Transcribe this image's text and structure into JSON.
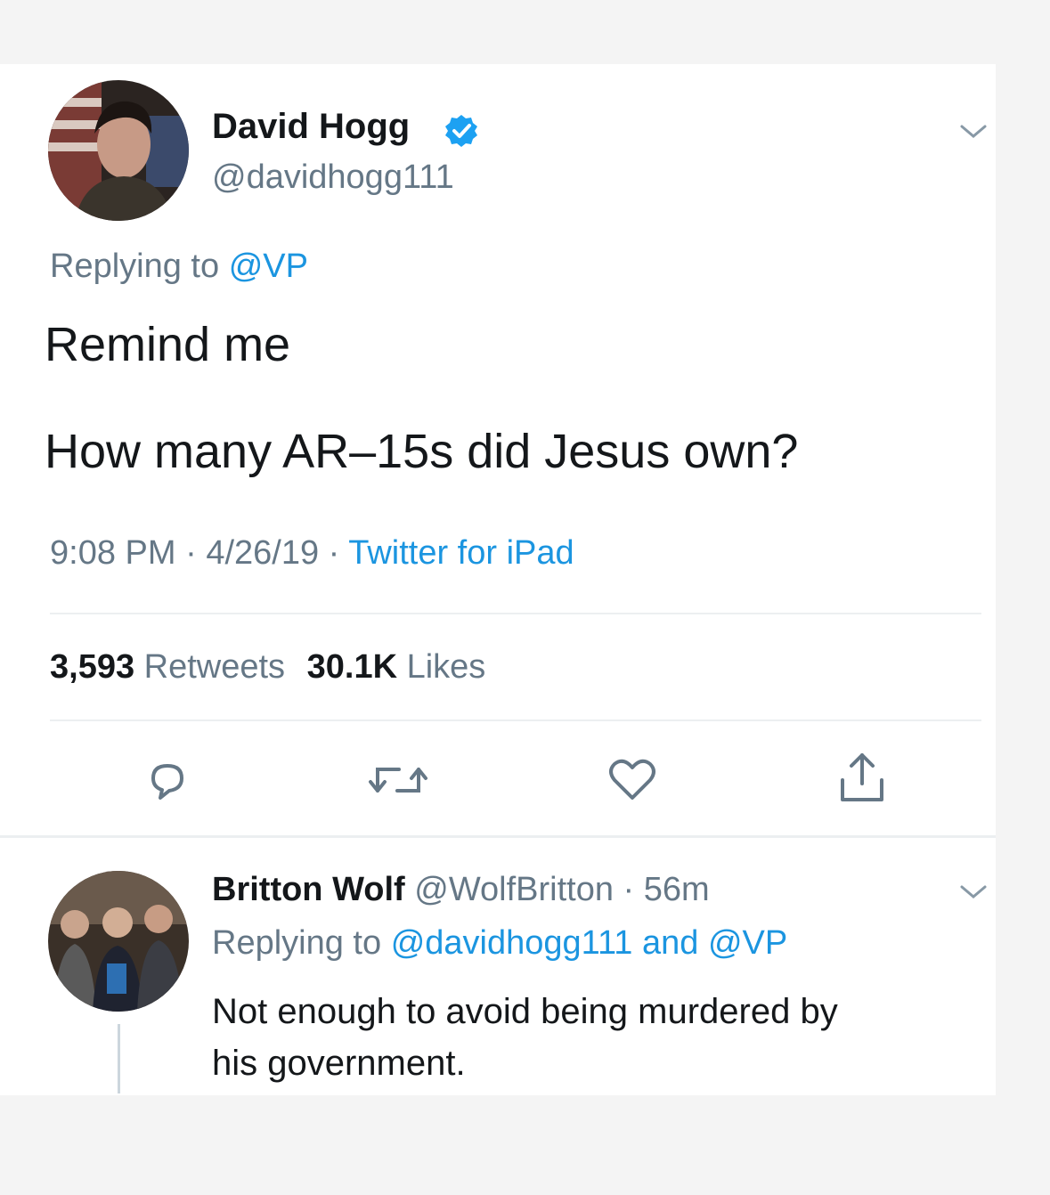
{
  "tweet": {
    "author": {
      "name": "David Hogg",
      "handle": "@davidhogg111",
      "verified": true,
      "verified_badge_icon": "verified-badge-icon"
    },
    "replying_prefix": "Replying to",
    "replying_to": "@VP",
    "text_line1": "Remind me",
    "text_line2": "How many AR–15s did Jesus own?",
    "time": "9:08 PM",
    "date": "4/26/19",
    "source": "Twitter for iPad",
    "dot": "·",
    "retweets_count": "3,593",
    "retweets_label": "Retweets",
    "likes_count": "30.1K",
    "likes_label": "Likes",
    "actions": [
      "reply-icon",
      "retweet-icon",
      "like-icon",
      "share-icon"
    ]
  },
  "reply": {
    "author": {
      "name": "Britton Wolf",
      "handle": "@WolfBritton"
    },
    "dot": "·",
    "age": "56m",
    "replying_prefix": "Replying to",
    "replying_to_1": "@davidhogg111",
    "and_word": "and",
    "replying_to_2": "@VP",
    "text_line1": "Not enough to avoid being murdered by",
    "text_line2": "his government."
  },
  "colors": {
    "link": "#1b95e0",
    "muted": "#657786",
    "text": "#14171a",
    "verified": "#1da1f2"
  }
}
